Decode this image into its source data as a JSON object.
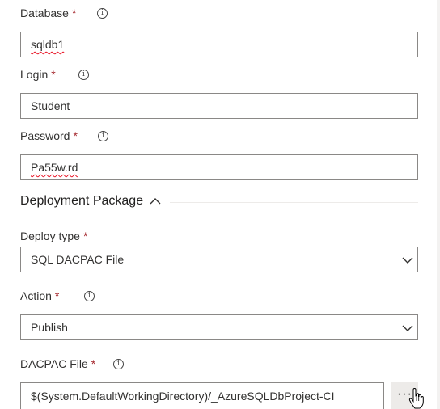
{
  "fields": {
    "database": {
      "label": "Database",
      "required_mark": "*",
      "value": "sqldb1",
      "info_icon": "info-icon"
    },
    "login": {
      "label": "Login",
      "required_mark": "*",
      "value": "Student",
      "info_icon": "info-icon"
    },
    "password": {
      "label": "Password",
      "required_mark": "*",
      "value": "Pa55w.rd",
      "info_icon": "info-icon"
    }
  },
  "section": {
    "title": "Deployment Package",
    "toggle_icon": "chevron-up-icon"
  },
  "deploy_type": {
    "label": "Deploy type",
    "required_mark": "*",
    "selected": "SQL DACPAC File",
    "icon": "chevron-down-icon"
  },
  "action": {
    "label": "Action",
    "required_mark": "*",
    "selected": "Publish",
    "icon": "chevron-down-icon",
    "info_icon": "info-icon"
  },
  "dacpac_file": {
    "label": "DACPAC File",
    "required_mark": "*",
    "value": "$(System.DefaultWorkingDirectory)/_AzureSQLDbProject-CI",
    "browse_label": "···",
    "info_icon": "info-icon"
  },
  "colors": {
    "required": "#a4262c",
    "border": "#8a8886",
    "text": "#323130",
    "button_bg": "#edebe9"
  }
}
